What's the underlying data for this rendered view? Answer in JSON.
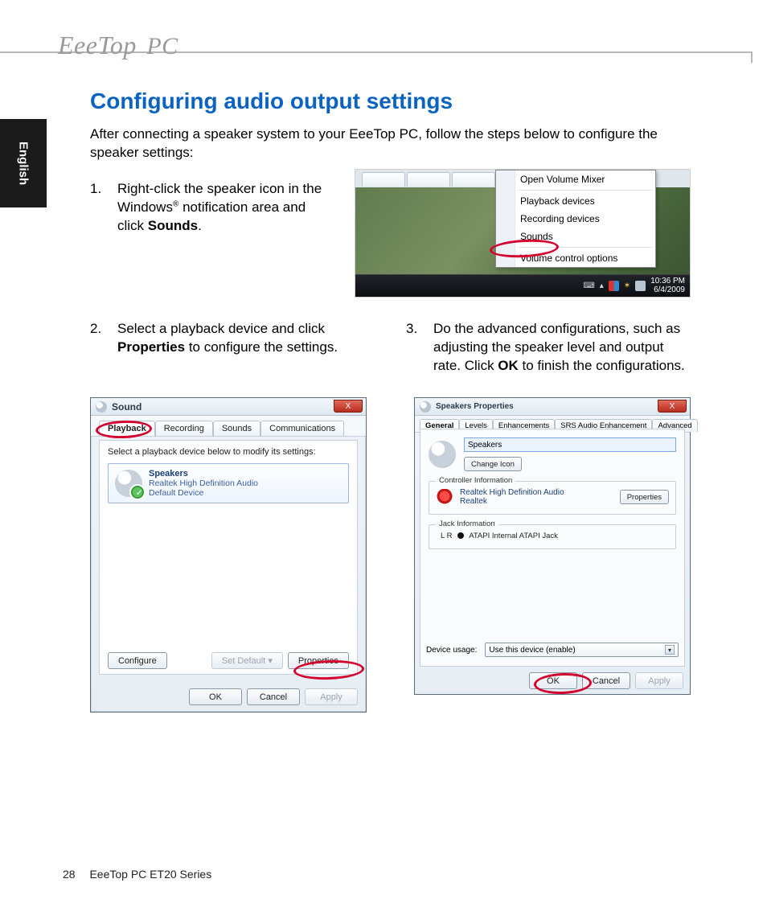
{
  "brand": {
    "name": "EeeTop",
    "suffix": "PC"
  },
  "sidebar": {
    "language": "English"
  },
  "heading": "Configuring audio output settings",
  "intro": "After connecting a speaker system to your EeeTop PC, follow the steps below to configure the speaker settings:",
  "step1": {
    "num": "1.",
    "text_a": "Right-click the speaker icon in the Windows",
    "reg": "®",
    "text_b": " notification area and click ",
    "bold": "Sounds",
    "text_c": "."
  },
  "step2": {
    "num": "2.",
    "text_a": "Select a playback device and click ",
    "bold": "Properties",
    "text_b": " to configure the settings."
  },
  "step3": {
    "num": "3.",
    "text_a": "Do the advanced configurations, such as adjusting the speaker level and output rate. Click ",
    "bold": "OK",
    "text_b": " to finish the configurations."
  },
  "ctxmenu": {
    "items": {
      "0": "Open Volume Mixer",
      "1": "Playback devices",
      "2": "Recording devices",
      "3": "Sounds",
      "4": "Volume control options"
    }
  },
  "tray": {
    "time": "10:36 PM",
    "date": "6/4/2009"
  },
  "sound_dialog": {
    "title": "Sound",
    "close": "X",
    "tabs": {
      "0": "Playback",
      "1": "Recording",
      "2": "Sounds",
      "3": "Communications"
    },
    "hint": "Select a playback device below to modify its settings:",
    "device": {
      "name": "Speakers",
      "sub1": "Realtek High Definition Audio",
      "sub2": "Default Device"
    },
    "buttons": {
      "configure": "Configure",
      "setdefault": "Set Default",
      "properties": "Properties",
      "ok": "OK",
      "cancel": "Cancel",
      "apply": "Apply"
    }
  },
  "props_dialog": {
    "title": "Speakers Properties",
    "close": "X",
    "tabs": {
      "0": "General",
      "1": "Levels",
      "2": "Enhancements",
      "3": "SRS Audio Enhancement",
      "4": "Advanced"
    },
    "name_input": "Speakers",
    "change_icon": "Change Icon",
    "controller_legend": "Controller Information",
    "controller_name": "Realtek High Definition Audio",
    "controller_vendor": "Realtek",
    "controller_props": "Properties",
    "jack_legend": "Jack Information",
    "jack_lr": "L R",
    "jack_desc": "ATAPI Internal ATAPI Jack",
    "usage_label": "Device usage:",
    "usage_value": "Use this device (enable)",
    "ok": "OK",
    "cancel": "Cancel",
    "apply": "Apply"
  },
  "footer": {
    "page": "28",
    "product": "EeeTop PC ET20 Series"
  }
}
